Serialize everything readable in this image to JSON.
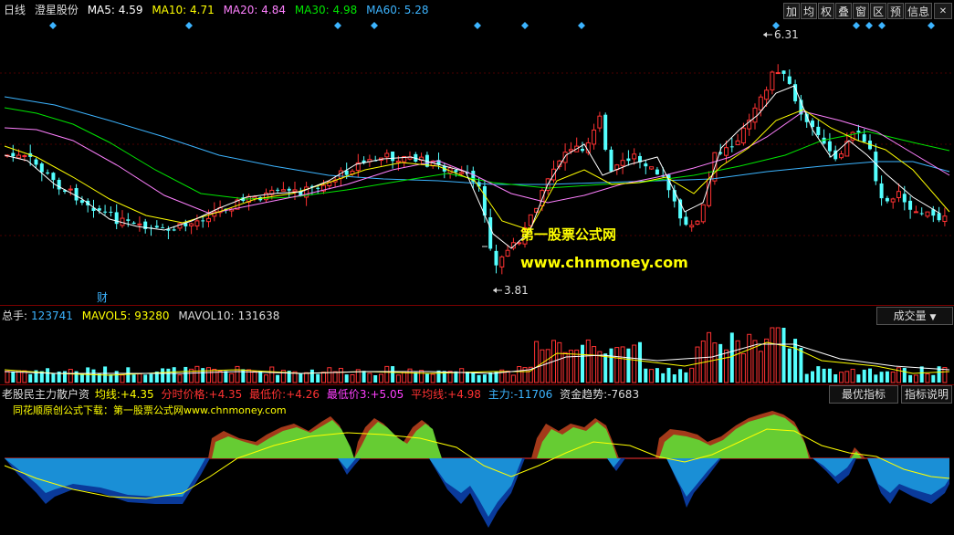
{
  "colors": {
    "up": "#ff3232",
    "down": "#54ffff",
    "ma5": "#ffffff",
    "ma10": "#ffff00",
    "ma20": "#ff80ff",
    "ma30": "#00e600",
    "ma60": "#3cb4ff",
    "watermark": "#ffff00",
    "oscillator_positive": "#66cc33",
    "oscillator_negative": "#1a8fd6"
  },
  "header": {
    "period": "日线",
    "stock_name": "澄星股份",
    "ma": [
      {
        "label": "MA5:",
        "value": "4.59"
      },
      {
        "label": "MA10:",
        "value": "4.71"
      },
      {
        "label": "MA20:",
        "value": "4.84"
      },
      {
        "label": "MA30:",
        "value": "4.98"
      },
      {
        "label": "MA60:",
        "value": "5.28"
      }
    ]
  },
  "toolbar": [
    {
      "label": "加",
      "icon": "add-icon"
    },
    {
      "label": "均",
      "icon": "average-icon"
    },
    {
      "label": "权",
      "icon": "rights-icon"
    },
    {
      "label": "叠",
      "icon": "overlay-icon"
    },
    {
      "label": "窗",
      "icon": "window-icon"
    },
    {
      "label": "区",
      "icon": "range-icon"
    },
    {
      "label": "预",
      "icon": "preview-icon"
    },
    {
      "label": "信息",
      "icon": "info-icon"
    }
  ],
  "price_chart": {
    "high_label": "6.31",
    "low_label": "3.81",
    "finance_marker": "财",
    "watermark_title": "第一股票公式网",
    "watermark_url": "www.chnmoney.com"
  },
  "volume_panel": {
    "total_label": "总手:",
    "total_value": "123741",
    "mavol5_label": "MAVOL5:",
    "mavol5_value": "93280",
    "mavol10_label": "MAVOL10:",
    "mavol10_value": "131638",
    "dropdown_value": "成交量"
  },
  "indicator_panel": {
    "name": "老股民主力散户资",
    "items": [
      {
        "label": "均线:",
        "value": "+4.35",
        "color": "#ffff00"
      },
      {
        "label": "分时价格:",
        "value": "+4.35",
        "color": "#ff3232"
      },
      {
        "label": "最低价:",
        "value": "+4.26",
        "color": "#ff3232"
      },
      {
        "label": "最低价3:",
        "value": "+5.05",
        "color": "#ff40ff"
      },
      {
        "label": "平均线:",
        "value": "+4.98",
        "color": "#ff3232"
      },
      {
        "label": "主力:",
        "value": "-11706",
        "color": "#3cb4ff"
      },
      {
        "label": "资金趋势:",
        "value": "-7683",
        "color": "#ffff00"
      }
    ],
    "best_button": "最优指标",
    "help_button": "指标说明",
    "download_note": "同花顺原创公式下载：第一股票公式网www.chnmoney.com"
  }
}
